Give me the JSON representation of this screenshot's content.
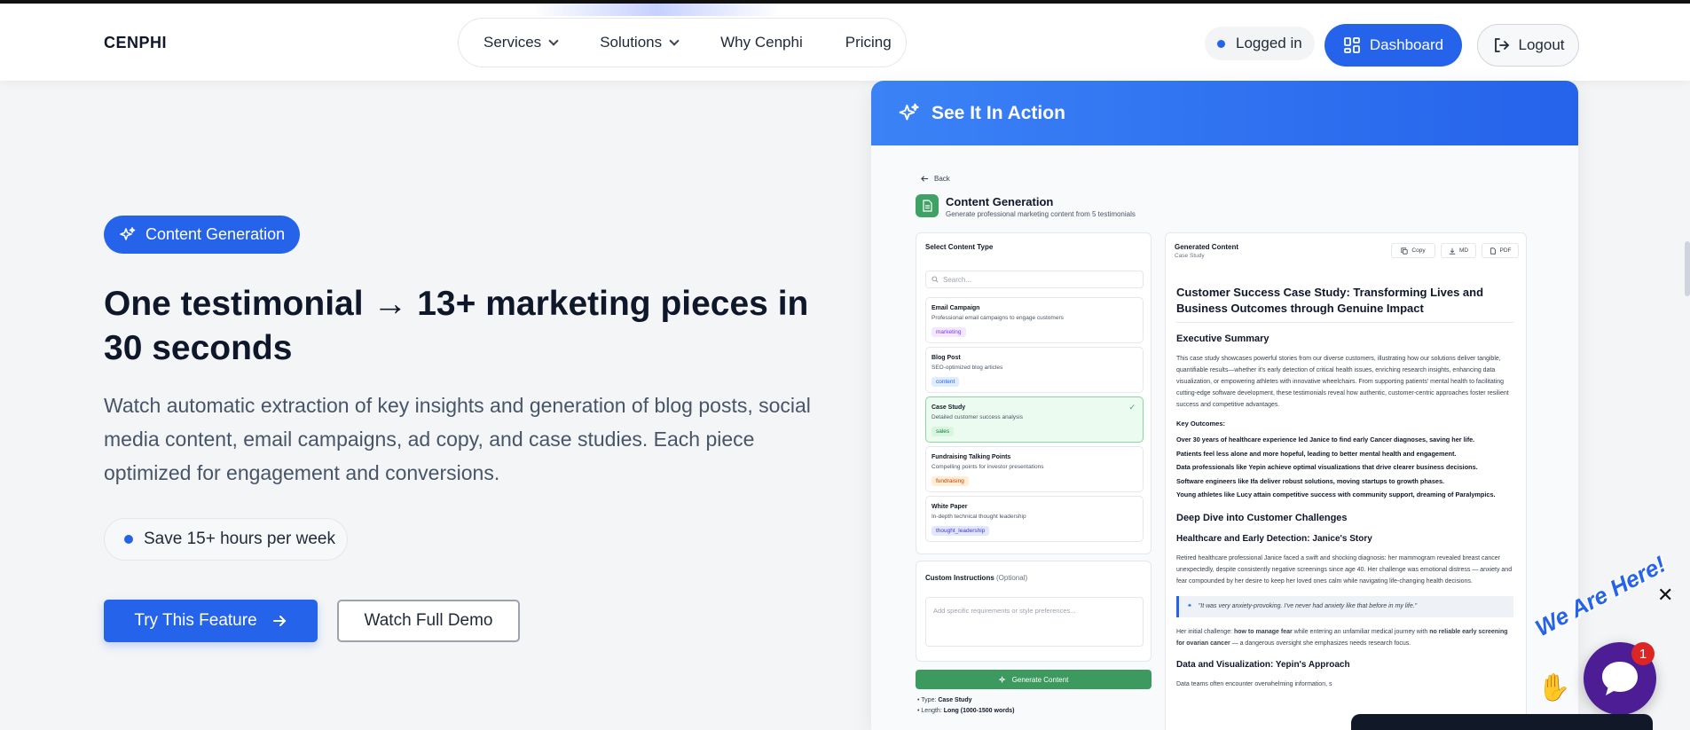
{
  "header": {
    "logo": "CENPHI",
    "nav": [
      {
        "label": "Services",
        "dropdown": true
      },
      {
        "label": "Solutions",
        "dropdown": true
      },
      {
        "label": "Why Cenphi",
        "dropdown": false
      },
      {
        "label": "Pricing",
        "dropdown": false
      }
    ],
    "status": "Logged in",
    "dashboard_label": "Dashboard",
    "logout_label": "Logout"
  },
  "hero": {
    "badge": "Content Generation",
    "title": "One testimonial → 13+ marketing pieces in 30 seconds",
    "description": "Watch automatic extraction of key insights and generation of blog posts, social media content, email campaigns, ad copy, and case studies. Each piece optimized for engagement and conversions.",
    "save_pill": "Save 15+ hours per week",
    "try_label": "Try This Feature",
    "watch_label": "Watch Full Demo"
  },
  "demo": {
    "header": "See It In Action",
    "back": "Back",
    "title": "Content Generation",
    "subtitle": "Generate professional marketing content from 5 testimonials",
    "select_title": "Select Content Type",
    "search_placeholder": "Search...",
    "content_types": [
      {
        "name": "Email Campaign",
        "desc": "Professional email campaigns to engage customers",
        "tag": "marketing",
        "tag_color": "#7c3aed",
        "tag_bg": "#f3e8ff",
        "selected": false
      },
      {
        "name": "Blog Post",
        "desc": "SEO-optimized blog articles",
        "tag": "content",
        "tag_color": "#2563eb",
        "tag_bg": "#e0ecff",
        "selected": false
      },
      {
        "name": "Case Study",
        "desc": "Detailed customer success analysis",
        "tag": "sales",
        "tag_color": "#15803d",
        "tag_bg": "#d7f5df",
        "selected": true
      },
      {
        "name": "Fundraising Talking Points",
        "desc": "Compelling points for investor presentations",
        "tag": "fundraising",
        "tag_color": "#c2410c",
        "tag_bg": "#ffedd5",
        "selected": false
      },
      {
        "name": "White Paper",
        "desc": "In-depth technical thought leadership",
        "tag": "thought_leadership",
        "tag_color": "#4338ca",
        "tag_bg": "#e0e7ff",
        "selected": false
      }
    ],
    "custom_title": "Custom Instructions",
    "custom_optional": "(Optional)",
    "custom_placeholder": "Add specific requirements or style preferences...",
    "generate_label": "Generate Content",
    "meta": [
      {
        "label": "Type:",
        "value": "Case Study"
      },
      {
        "label": "Length:",
        "value": "Long (1000-1500 words)"
      }
    ],
    "generated": {
      "title": "Generated Content",
      "subtitle": "Case Study",
      "buttons": [
        "Copy",
        "MD",
        "PDF"
      ],
      "doc_title": "Customer Success Case Study: Transforming Lives and Business Outcomes through Genuine Impact",
      "exec_heading": "Executive Summary",
      "exec_text": "This case study showcases powerful stories from our diverse customers, illustrating how our solutions deliver tangible, quantifiable results—whether it's early detection of critical health issues, enriching research insights, enhancing data visualization, or empowering athletes with innovative wheelchairs. From supporting patients' mental health to facilitating cutting-edge software development, these testimonials reveal how authentic, customer-centric approaches foster resilient success and competitive advantages.",
      "key_outcomes_label": "Key Outcomes:",
      "key_outcomes": [
        "Over 30 years of healthcare experience led Janice to find early Cancer diagnoses, saving her life.",
        "Patients feel less alone and more hopeful, leading to better mental health and engagement.",
        "Data professionals like Yepin achieve optimal visualizations that drive clearer business decisions.",
        "Software engineers like Ifa deliver robust solutions, moving startups to growth phases.",
        "Young athletes like Lucy attain competitive success with community support, dreaming of Paralympics."
      ],
      "deep_dive_heading": "Deep Dive into Customer Challenges",
      "janice_heading": "Healthcare and Early Detection: Janice's Story",
      "janice_text": "Retired healthcare professional Janice faced a swift and shocking diagnosis: her mammogram revealed breast cancer unexpectedly, despite consistently negative screenings since age 40. Her challenge was emotional distress — anxiety and fear compounded by her desire to keep her loved ones calm while navigating life-changing health decisions.",
      "quote": "\"It was very anxiety-provoking. I've never had anxiety like that before in my life.\"",
      "initial_text_a": "Her initial challenge: ",
      "initial_bold_a": "how to manage fear",
      "initial_text_b": " while entering an unfamiliar medical journey with ",
      "initial_bold_b": "no reliable early screening for ovarian cancer",
      "initial_text_c": " — a dangerous oversight she emphasizes needs research focus.",
      "yepin_heading": "Data and Visualization: Yepin's Approach",
      "yepin_text": "Data teams often encounter overwhelming information, s"
    }
  },
  "widget": {
    "tagline": "We Are Here!",
    "badge_count": "1"
  }
}
